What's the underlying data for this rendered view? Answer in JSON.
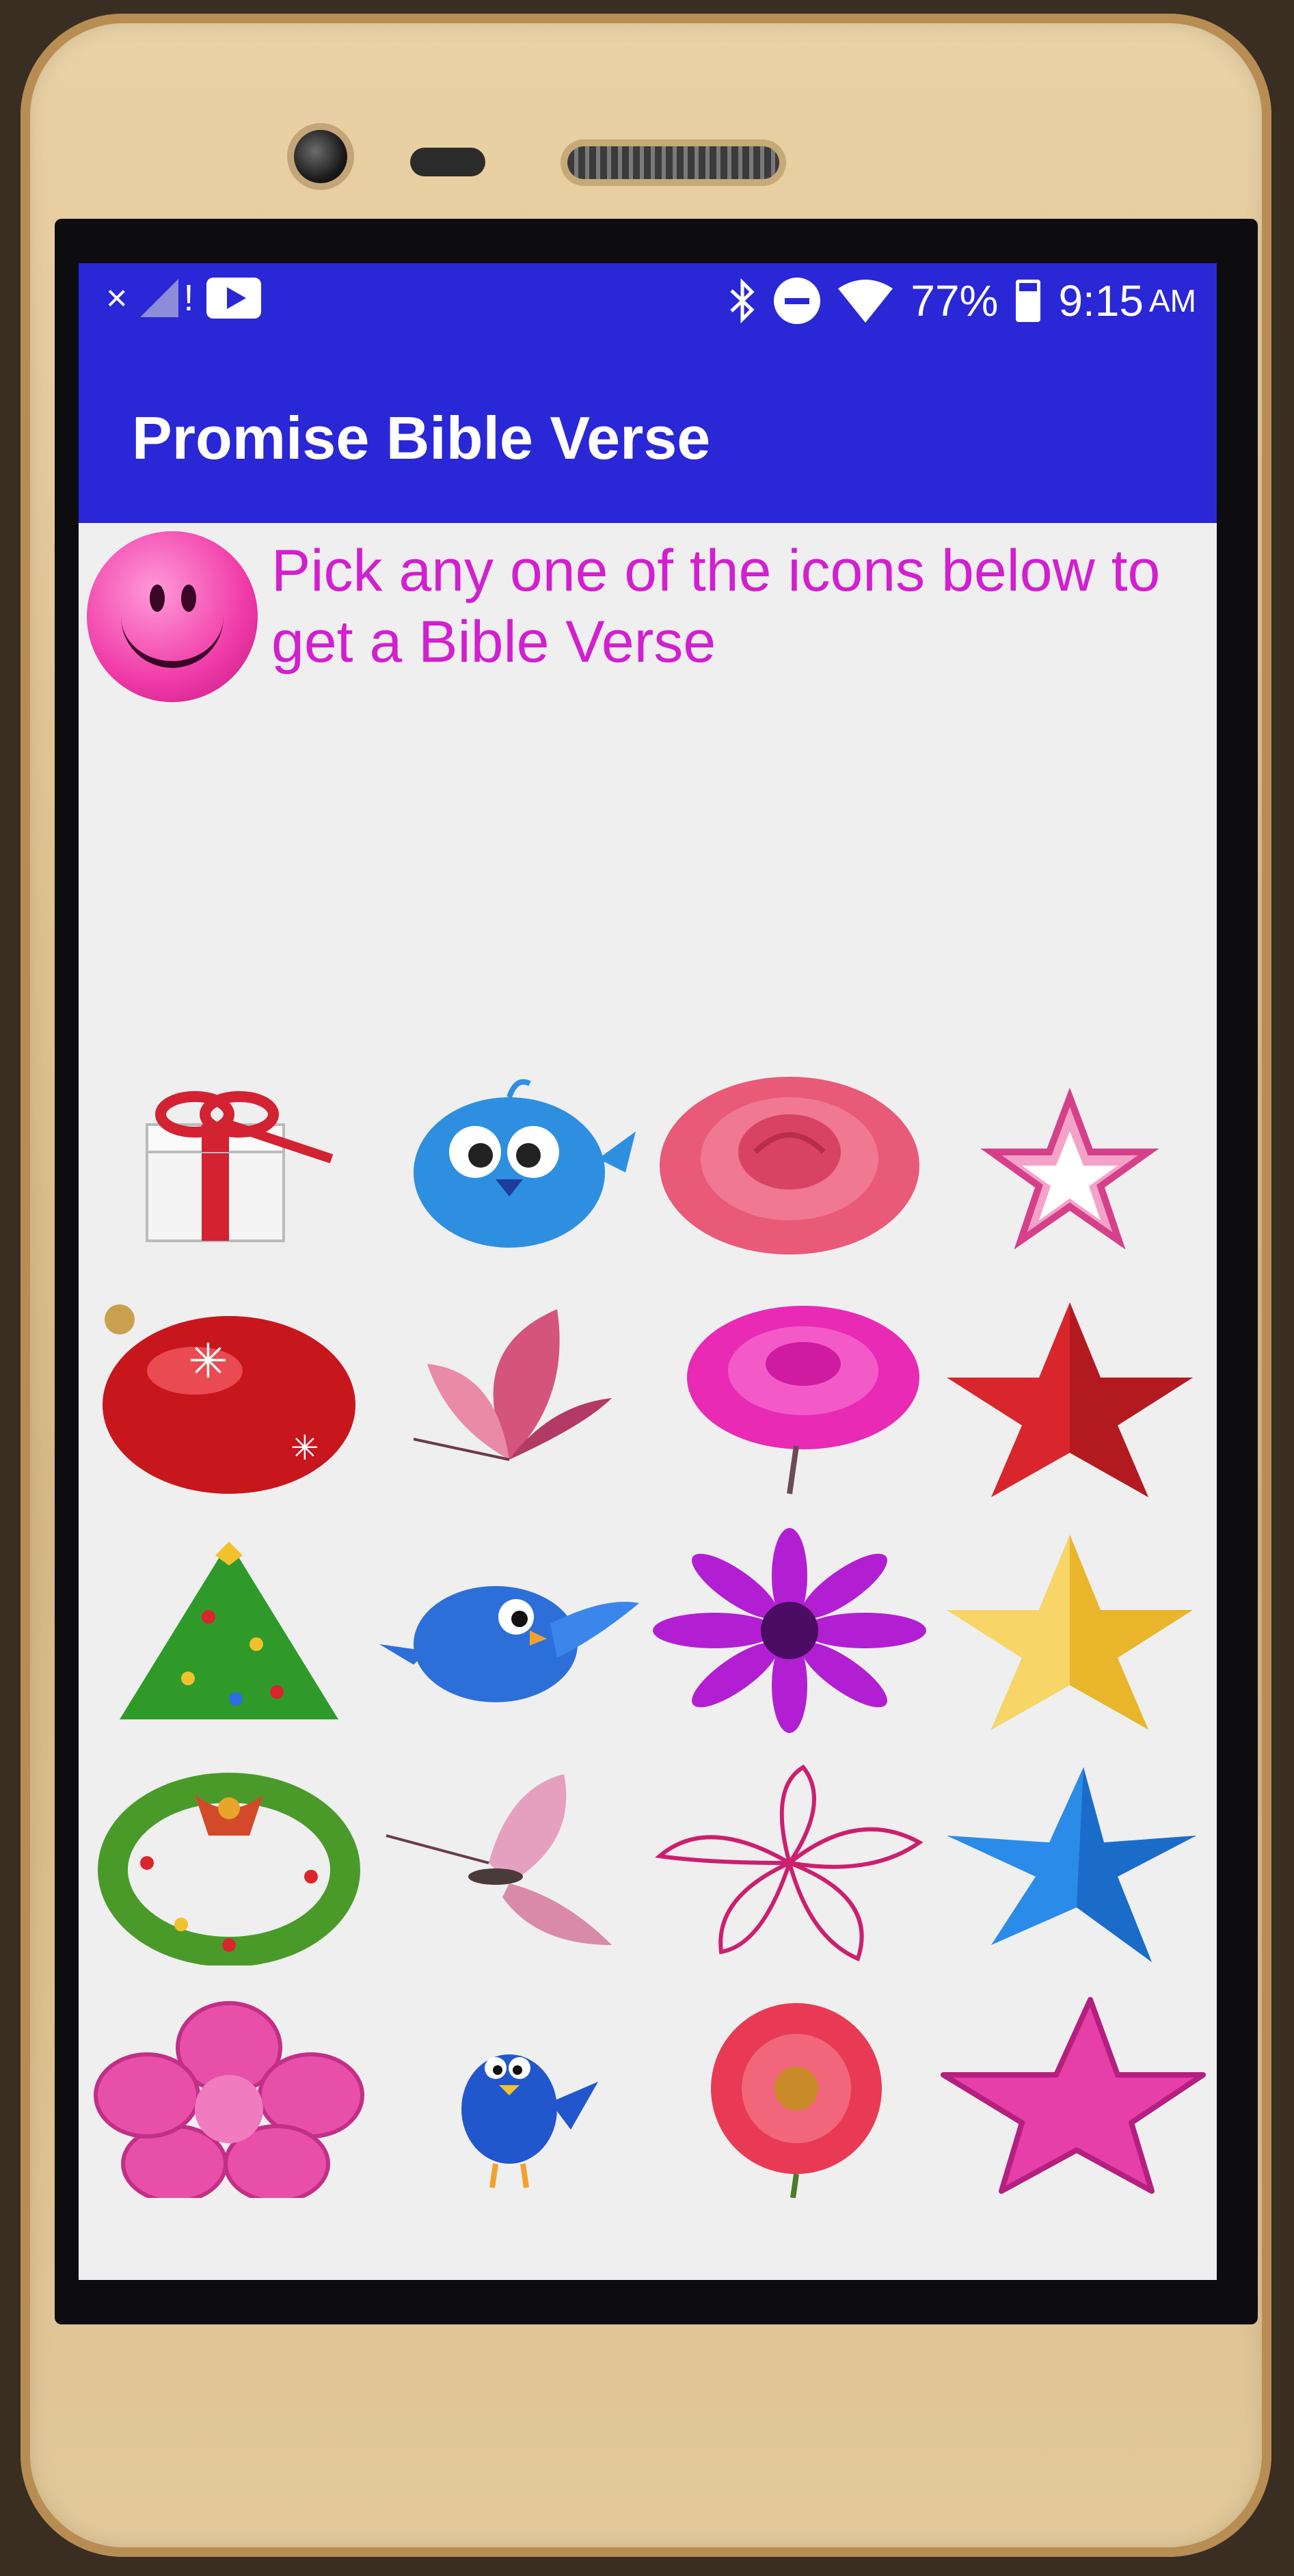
{
  "status_bar": {
    "signal_text": "×",
    "alert_text": "!",
    "battery_percent": "77%",
    "time": "9:15",
    "ampm": "AM",
    "icons": [
      "bluetooth-icon",
      "do-not-disturb-icon",
      "wifi-icon",
      "battery-icon",
      "youtube-notification-icon"
    ]
  },
  "app_bar": {
    "title": "Promise Bible Verse"
  },
  "header": {
    "instruction": "Pick any one of the icons below to get a Bible Verse",
    "avatar_icon": "smiley-face-icon"
  },
  "grid": {
    "rows": [
      [
        "gift-box-icon",
        "blue-bird-icon",
        "pink-rose-icon",
        "pink-outline-star-icon"
      ],
      [
        "red-ornament-icon",
        "pink-butterfly-icon",
        "magenta-rose-icon",
        "red-star-icon"
      ],
      [
        "christmas-tree-icon",
        "flying-blue-bird-icon",
        "purple-daisy-icon",
        "gold-star-icon"
      ],
      [
        "holiday-wreath-icon",
        "light-pink-butterfly-icon",
        "outline-flower-icon",
        "blue-star-icon"
      ],
      [
        "pink-flower-icon",
        "small-blue-bird-icon",
        "gerbera-flower-icon",
        "pink-star-icon"
      ]
    ]
  },
  "colors": {
    "app_bar": "#2a27d6",
    "instruction_text": "#d21fcf",
    "background": "#efefef"
  }
}
